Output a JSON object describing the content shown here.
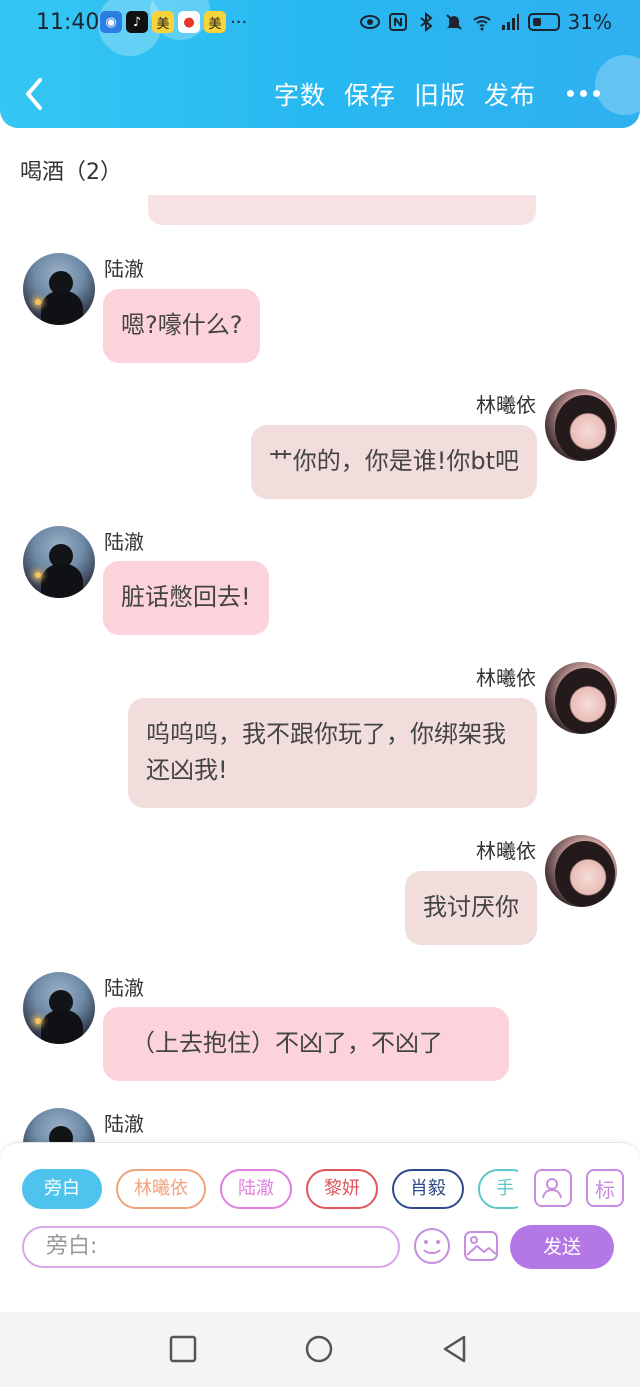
{
  "status_bar": {
    "time": "11:40",
    "battery": "31%",
    "app_icons": [
      "美",
      "美"
    ]
  },
  "header": {
    "actions": [
      "字数",
      "保存",
      "旧版",
      "发布"
    ]
  },
  "chapter": {
    "title": "喝酒（2）"
  },
  "messages": [
    {
      "side": "left",
      "name": "陆澈",
      "text": "嗯?嚎什么?"
    },
    {
      "side": "right",
      "name": "林曦依",
      "text": "艹你的，你是谁!你bt吧"
    },
    {
      "side": "left",
      "name": "陆澈",
      "text": "脏话憋回去!"
    },
    {
      "side": "right",
      "name": "林曦依",
      "text": "呜呜呜，我不跟你玩了，你绑架我还凶我!"
    },
    {
      "side": "right",
      "name": "林曦依",
      "text": "我讨厌你"
    },
    {
      "side": "left",
      "name": "陆澈",
      "text": "（上去抱住）不凶了，不凶了"
    },
    {
      "side": "left",
      "name": "陆澈",
      "text": ""
    }
  ],
  "composer": {
    "roles": [
      {
        "label": "旁白",
        "color": "#4dc3ee"
      },
      {
        "label": "林曦依",
        "color": "#f0a27c"
      },
      {
        "label": "陆澈",
        "color": "#e07ee0"
      },
      {
        "label": "黎妍",
        "color": "#e0555a"
      },
      {
        "label": "肖毅",
        "color": "#2d4a8a"
      },
      {
        "label": "手",
        "color": "#5dc8c8"
      }
    ],
    "tag_button": "标",
    "input_placeholder": "旁白:",
    "send_label": "发送"
  },
  "colors": {
    "header_blue": "#28b8f1",
    "left_bubble": "#fcd3db",
    "right_bubble": "#f2dddd",
    "send_purple": "#b377e6"
  }
}
